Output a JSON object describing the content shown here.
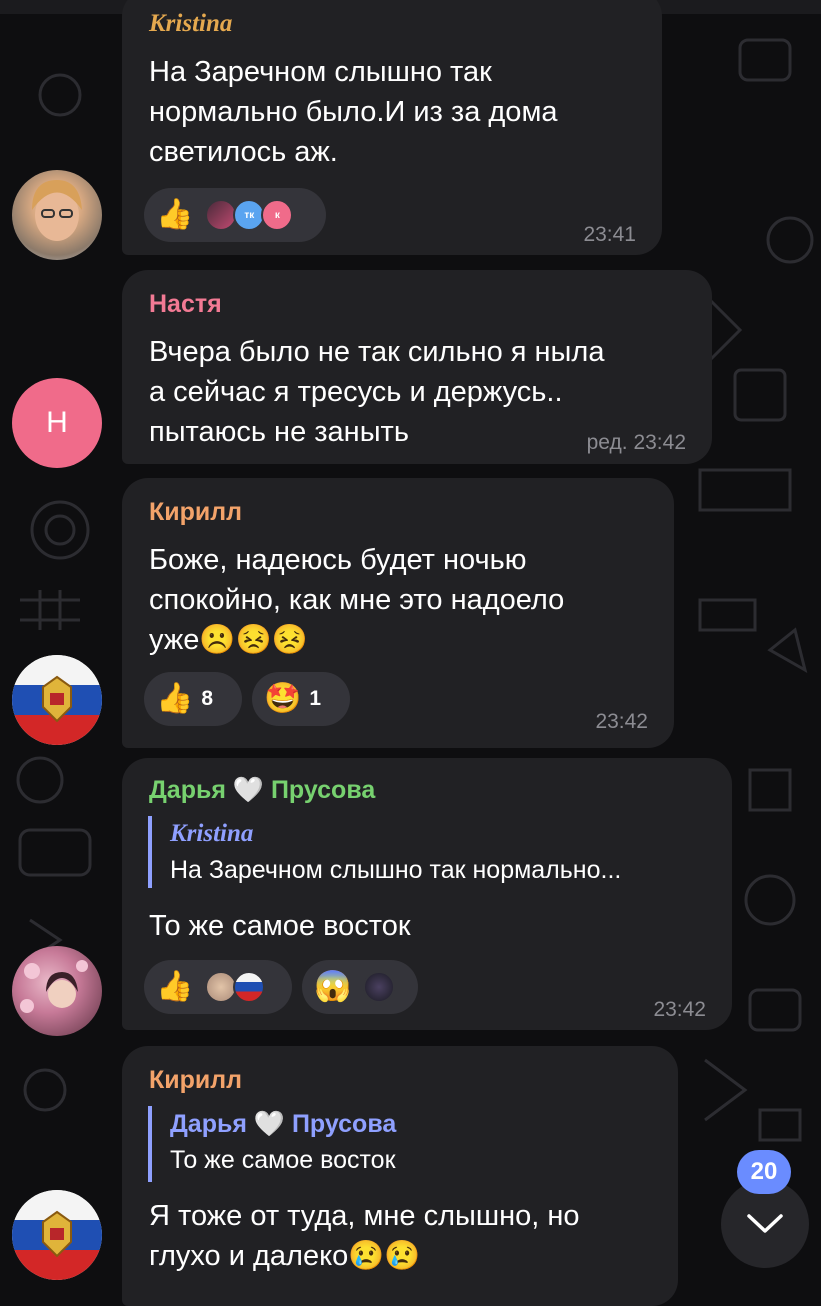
{
  "colors": {
    "background": "#0e0e10",
    "bubble": "#212124",
    "reaction_pill": "#34343a",
    "timestamp": "#8c8c92",
    "sender_kristina": "#e5a94f",
    "sender_nastya": "#f27a94",
    "sender_kirill": "#f3a36a",
    "sender_darya": "#77d16f",
    "reply_accent": "#8fa0ff",
    "badge": "#6a8cff"
  },
  "messages": [
    {
      "sender": "Kristina",
      "lines": [
        "На Заречном слышно так",
        "нормально было.И из за дома",
        "светилось аж."
      ],
      "reactions": [
        {
          "emoji": "👍",
          "icon": "thumbs-up",
          "avatars": [
            "photo",
            "тк",
            "к"
          ]
        }
      ],
      "time": "23:41"
    },
    {
      "sender": "Настя",
      "avatar_letter": "Н",
      "lines": [
        "Вчера было не так сильно я ныла",
        "а сейчас я тресусь и держусь..",
        "пытаюсь не заныть"
      ],
      "time": "ред. 23:42"
    },
    {
      "sender": "Кирилл",
      "lines": [
        "Боже, надеюсь будет ночью",
        "спокойно, как мне это надоело",
        "уже☹️😣😣"
      ],
      "reactions": [
        {
          "emoji": "👍",
          "icon": "thumbs-up",
          "count": "8"
        },
        {
          "emoji": "🤩",
          "icon": "star-struck",
          "count": "1"
        }
      ],
      "time": "23:42"
    },
    {
      "sender": "Дарья 🤍 Прусова",
      "reply": {
        "name": "Kristina",
        "text": "На Заречном слышно так нормально..."
      },
      "lines": [
        "То же самое восток"
      ],
      "reactions": [
        {
          "emoji": "👍",
          "icon": "thumbs-up",
          "avatars": [
            "photo",
            "flag"
          ]
        },
        {
          "emoji": "😱",
          "icon": "scream",
          "avatars": [
            "photo"
          ]
        }
      ],
      "time": "23:42"
    },
    {
      "sender": "Кирилл",
      "reply": {
        "name": "Дарья 🤍 Прусова",
        "text": "То же самое восток"
      },
      "lines": [
        "Я тоже от туда, мне слышно, но",
        "глухо и далеко😢😢"
      ]
    }
  ],
  "scroll": {
    "unread_count": "20",
    "icon": "chevron-down-icon"
  }
}
